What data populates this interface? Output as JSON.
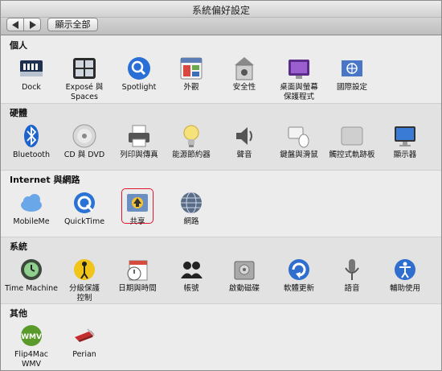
{
  "window": {
    "title": "系統偏好設定"
  },
  "toolbar": {
    "show_all": "顯示全部"
  },
  "sections": {
    "personal": {
      "title": "個人",
      "items": [
        "Dock",
        "Exposé 與\nSpaces",
        "Spotlight",
        "外觀",
        "安全性",
        "桌面與螢幕\n保護程式",
        "國際設定"
      ]
    },
    "hardware": {
      "title": "硬體",
      "items": [
        "Bluetooth",
        "CD 與 DVD",
        "列印與傳真",
        "能源節約器",
        "聲音",
        "鍵盤與滑鼠",
        "觸控式軌跡板",
        "顯示器"
      ]
    },
    "internet": {
      "title": "Internet 與網路",
      "items": [
        "MobileMe",
        "QuickTime",
        "共享",
        "網路"
      ]
    },
    "system": {
      "title": "系統",
      "items": [
        "Time Machine",
        "分級保護\n控制",
        "日期與時間",
        "帳號",
        "啟動磁碟",
        "軟體更新",
        "語音",
        "輔助使用"
      ]
    },
    "other": {
      "title": "其他",
      "items": [
        "Flip4Mac\nWMV",
        "Perian"
      ]
    }
  },
  "highlighted_item": "共享",
  "icons": [
    "dock-icon",
    "expose-icon",
    "spotlight-icon",
    "appearance-icon",
    "security-icon",
    "desktop-icon",
    "international-icon",
    "bluetooth-icon",
    "cd-icon",
    "printer-icon",
    "energy-icon",
    "sound-icon",
    "keyboard-icon",
    "trackpad-icon",
    "display-icon",
    "mobileme-icon",
    "quicktime-icon",
    "sharing-icon",
    "network-icon",
    "timemachine-icon",
    "parental-icon",
    "datetime-icon",
    "accounts-icon",
    "startup-disk-icon",
    "software-update-icon",
    "speech-icon",
    "accessibility-icon",
    "flip4mac-icon",
    "perian-icon"
  ],
  "colors": {
    "highlight": "#e0182d"
  }
}
